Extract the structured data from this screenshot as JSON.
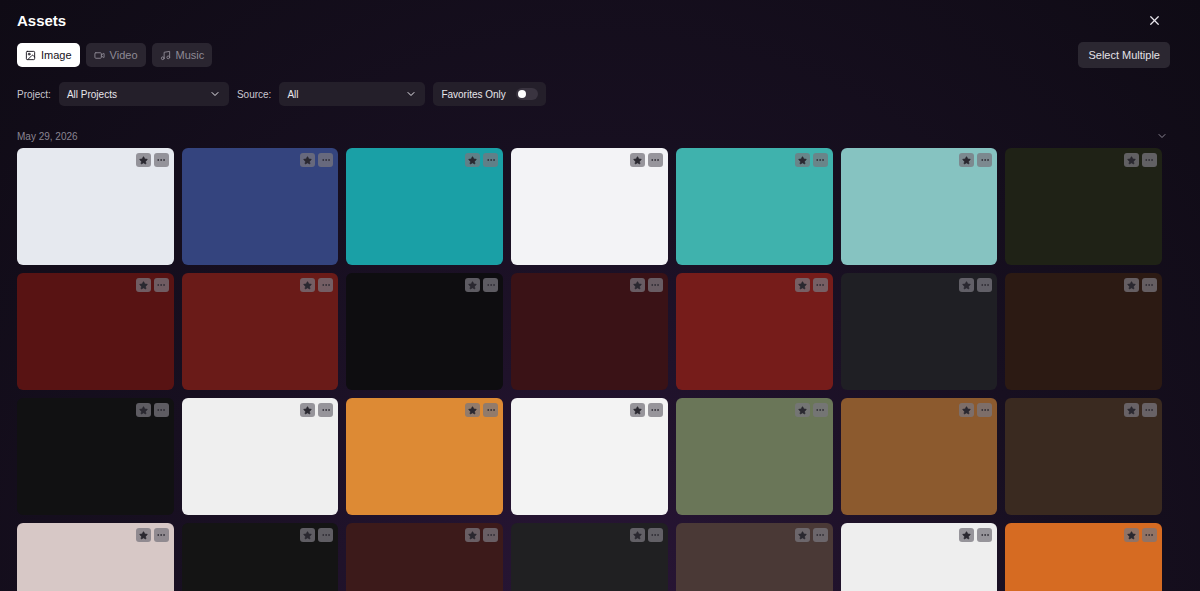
{
  "header": {
    "title": "Assets"
  },
  "tabs": [
    {
      "label": "Image",
      "selected": true
    },
    {
      "label": "Video",
      "selected": false
    },
    {
      "label": "Music",
      "selected": false
    }
  ],
  "actions": {
    "select_multiple": "Select Multiple"
  },
  "filters": {
    "project": {
      "label": "Project:",
      "value": "All Projects"
    },
    "source": {
      "label": "Source:",
      "value": "All"
    },
    "favorites_only": {
      "label": "Favorites Only",
      "on": false
    }
  },
  "groups": [
    {
      "date": "May 29, 2026",
      "expanded": true,
      "assets": [
        {
          "favorite": false,
          "color": "#e6e9ef"
        },
        {
          "favorite": false,
          "color": "#34447e"
        },
        {
          "favorite": false,
          "color": "#1aa0a6"
        },
        {
          "favorite": false,
          "color": "#f3f3f6"
        },
        {
          "favorite": false,
          "color": "#3fb2ad"
        },
        {
          "favorite": false,
          "color": "#86c3c1"
        },
        {
          "favorite": false,
          "color": "#1f2216"
        },
        {
          "favorite": false,
          "color": "#581313"
        },
        {
          "favorite": false,
          "color": "#6a1b18"
        },
        {
          "favorite": false,
          "color": "#0e0d10"
        },
        {
          "favorite": false,
          "color": "#3a1216"
        },
        {
          "favorite": false,
          "color": "#761c1a"
        },
        {
          "favorite": false,
          "color": "#1f1f24"
        },
        {
          "favorite": false,
          "color": "#2c1a13"
        },
        {
          "favorite": false,
          "color": "#111112"
        },
        {
          "favorite": false,
          "color": "#efefef"
        },
        {
          "favorite": false,
          "color": "#dd8a34"
        },
        {
          "favorite": false,
          "color": "#f3f3f3"
        },
        {
          "favorite": false,
          "color": "#6a7658"
        },
        {
          "favorite": false,
          "color": "#8c5a2e"
        },
        {
          "favorite": false,
          "color": "#3a2a20"
        },
        {
          "favorite": false,
          "color": "#d7c8c6"
        },
        {
          "favorite": false,
          "color": "#141414"
        },
        {
          "favorite": false,
          "color": "#3c1a1a"
        },
        {
          "favorite": false,
          "color": "#202022"
        },
        {
          "favorite": false,
          "color": "#4a3936"
        },
        {
          "favorite": false,
          "color": "#eeeeee"
        },
        {
          "favorite": false,
          "color": "#d66b22"
        }
      ]
    }
  ]
}
